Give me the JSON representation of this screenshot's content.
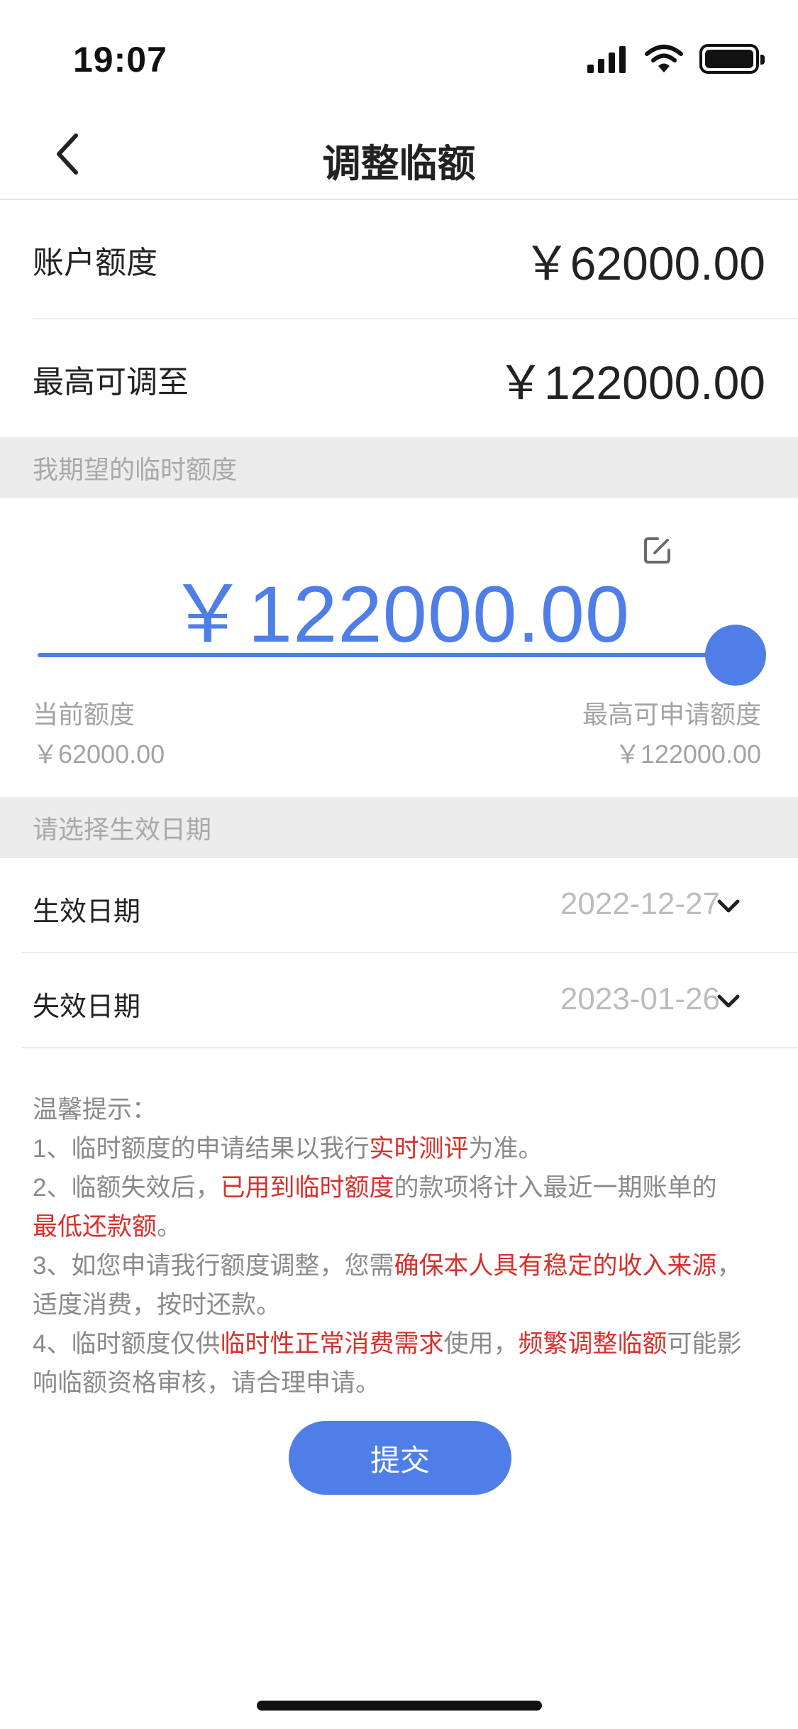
{
  "status_bar": {
    "time": "19:07"
  },
  "nav": {
    "title": "调整临额"
  },
  "account_limit": {
    "label": "账户额度",
    "value": "￥62000.00"
  },
  "max_adjust": {
    "label": "最高可调至",
    "value": "￥122000.00"
  },
  "expected_section": {
    "header": "我期望的临时额度"
  },
  "slider": {
    "amount": "￥122000.00",
    "fraction": 1.0,
    "current_label": "当前额度",
    "current_value": "￥62000.00",
    "max_label": "最高可申请额度",
    "max_value": "￥122000.00"
  },
  "date_section": {
    "header": "请选择生效日期",
    "effective": {
      "label": "生效日期",
      "value": "2022-12-27"
    },
    "expiry": {
      "label": "失效日期",
      "value": "2023-01-26"
    }
  },
  "tips": {
    "title": "温馨提示：",
    "items": [
      {
        "a": "1、临时额度的申请结果以我行",
        "b": "实时测评",
        "c": "为准。"
      },
      {
        "a": "2、临额失效后，",
        "b": "已用到临时额度",
        "c": "的款项将计入最近一期账单的",
        "d": "最低还款额",
        "e": "。"
      },
      {
        "a": "3、如您申请我行额度调整，您需",
        "b": "确保本人具有稳定的收入来源",
        "c": "，适度消费，按时还款。"
      },
      {
        "a": "4、临时额度仅供",
        "b": "临时性正常消费需求",
        "c": "使用，",
        "d": "频繁调整临额",
        "e": "可能影响临额资格审核，请合理申请。"
      }
    ]
  },
  "submit": {
    "label": "提交"
  },
  "colors": {
    "accent": "#4f7ee8",
    "highlight": "#d8302c",
    "muted": "#a3a3a3"
  }
}
